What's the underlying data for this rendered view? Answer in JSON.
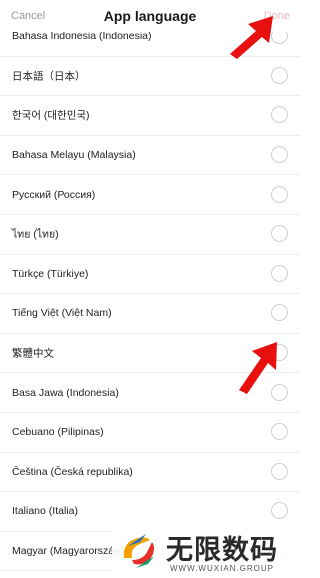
{
  "header": {
    "cancel_label": "Cancel",
    "title": "App language",
    "done_label": "Done"
  },
  "languages": [
    {
      "label": "Bahasa Indonesia (Indonesia)"
    },
    {
      "label": "日本語（日本）"
    },
    {
      "label": "한국어 (대한민국)"
    },
    {
      "label": "Bahasa Melayu (Malaysia)"
    },
    {
      "label": "Русский (Россия)"
    },
    {
      "label": "ไทย (ไทย)"
    },
    {
      "label": "Türkçe (Türkiye)"
    },
    {
      "label": "Tiếng Việt (Việt Nam)"
    },
    {
      "label": "繁體中文"
    },
    {
      "label": "Basa Jawa (Indonesia)"
    },
    {
      "label": "Cebuano (Pilipinas)"
    },
    {
      "label": "Čeština (Česká republika)"
    },
    {
      "label": "Italiano (Italia)"
    },
    {
      "label": "Magyar (Magyarország)"
    }
  ],
  "watermark": {
    "name": "无限数码",
    "url": "WWW.WUXIAN.GROUP"
  },
  "colors": {
    "done_disabled": "#f6b6bf",
    "arrow": "#e8100f"
  }
}
